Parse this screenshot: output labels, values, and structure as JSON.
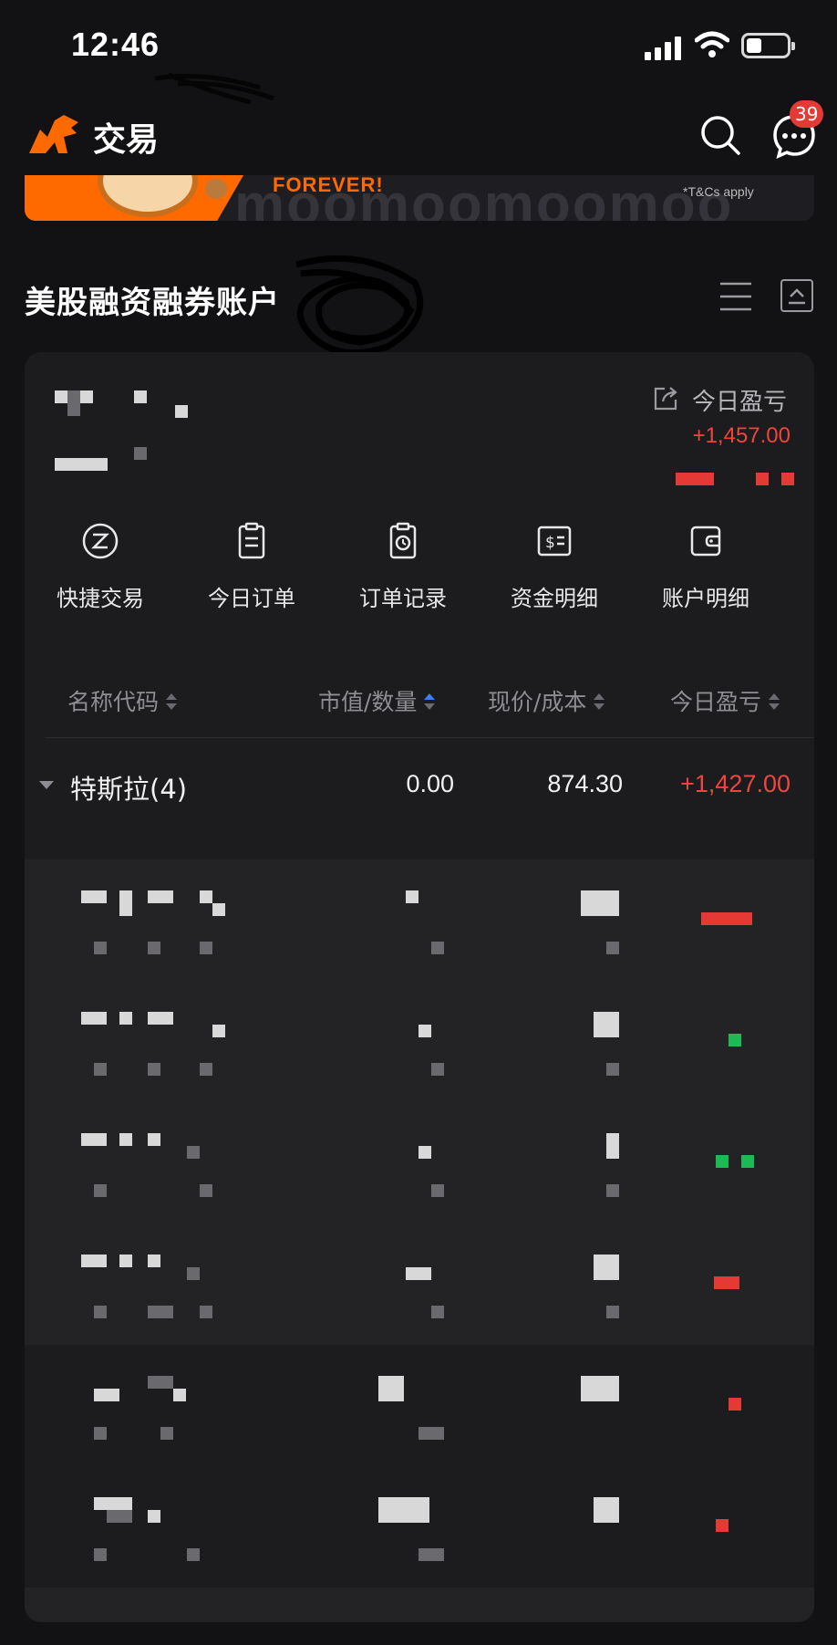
{
  "status_bar": {
    "time": "12:46"
  },
  "header": {
    "title": "交易",
    "message_badge": "39"
  },
  "banner": {
    "headline": "FOREVER!",
    "terms": "*T&Cs apply",
    "watermark": "moomoomoomoo"
  },
  "account": {
    "title": "美股融资融券账户",
    "today_pnl_label": "今日盈亏",
    "today_pnl_value": "+1,457.00"
  },
  "actions": [
    {
      "label": "快捷交易",
      "icon": "quick-trade-icon"
    },
    {
      "label": "今日订单",
      "icon": "clipboard-icon"
    },
    {
      "label": "订单记录",
      "icon": "order-history-icon"
    },
    {
      "label": "资金明细",
      "icon": "money-icon"
    },
    {
      "label": "账户明细",
      "icon": "wallet-icon"
    }
  ],
  "table": {
    "headers": {
      "name": "名称代码",
      "market_value": "市值/数量",
      "price": "现价/成本",
      "pnl": "今日盈亏"
    },
    "group": {
      "name": "特斯拉(4)",
      "market_value": "0.00",
      "price": "874.30",
      "pnl": "+1,427.00"
    }
  },
  "colors": {
    "background": "#121214",
    "card": "#1c1c1e",
    "gain_red": "#f0453e",
    "brand_orange": "#ff6a00",
    "sort_active_blue": "#3d7bff"
  }
}
